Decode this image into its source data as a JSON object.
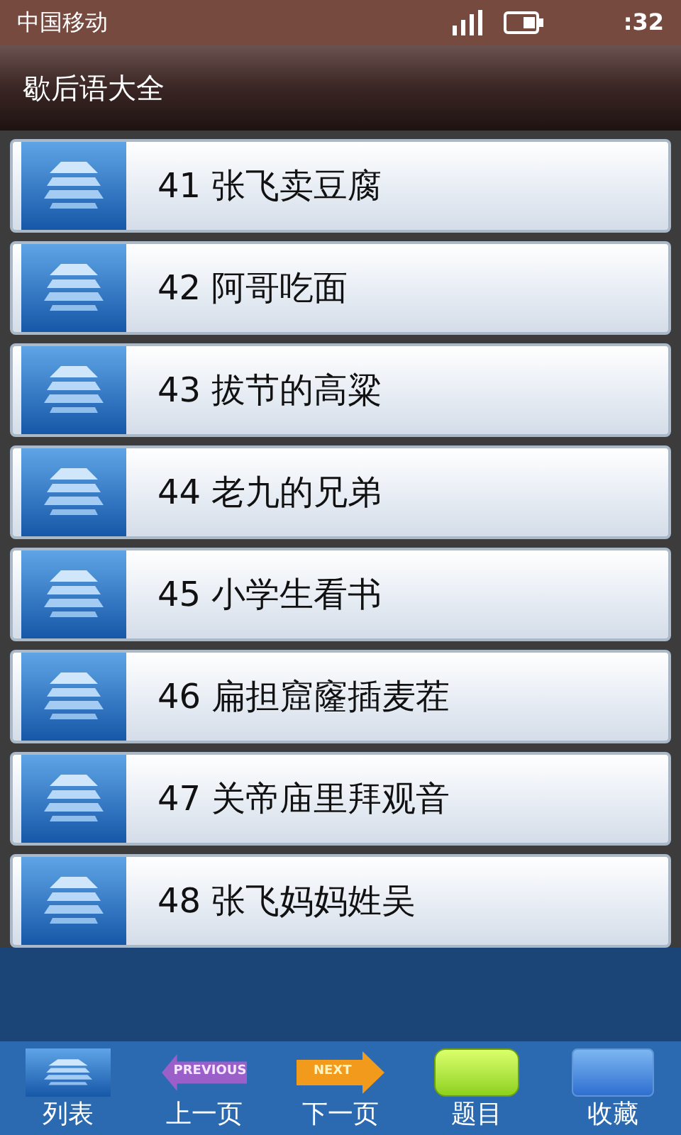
{
  "status_bar": {
    "carrier": "中国移动",
    "time": ":32"
  },
  "title_bar": {
    "title": "歇后语大全"
  },
  "list": [
    {
      "label": "41 张飞卖豆腐"
    },
    {
      "label": "42 阿哥吃面"
    },
    {
      "label": "43 拔节的高粱"
    },
    {
      "label": "44 老九的兄弟"
    },
    {
      "label": "45 小学生看书"
    },
    {
      "label": "46 扁担窟窿插麦茬"
    },
    {
      "label": "47 关帝庙里拜观音"
    },
    {
      "label": "48 张飞妈妈姓吴"
    }
  ],
  "toolbar": [
    {
      "kind": "list",
      "label": "列表"
    },
    {
      "kind": "previous",
      "label": "上一页",
      "icon_text": "PREVIOUS"
    },
    {
      "kind": "next",
      "label": "下一页",
      "icon_text": "NEXT"
    },
    {
      "kind": "topics",
      "label": "题目"
    },
    {
      "kind": "favorites",
      "label": "收藏"
    }
  ]
}
